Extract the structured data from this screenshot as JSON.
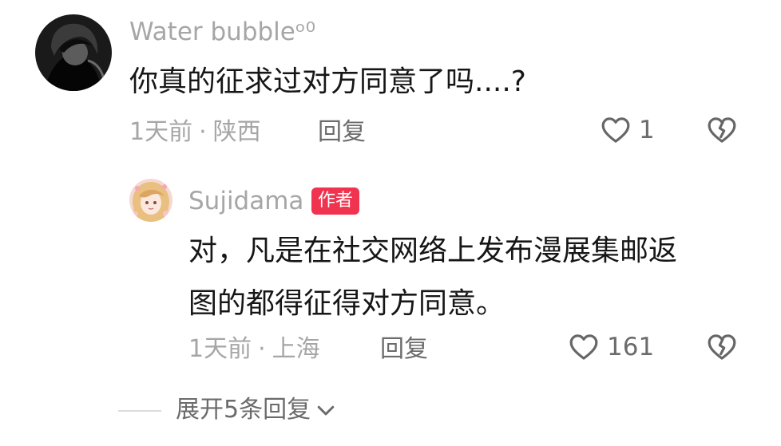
{
  "comment": {
    "username": "Water bubbleᵒ⁰",
    "text": "你真的征求过对方同意了吗....?",
    "time": "1天前",
    "separator": "·",
    "location": "陕西",
    "reply_label": "回复",
    "like_count": "1"
  },
  "reply": {
    "username": "Sujidama",
    "badge": "作者",
    "text_line1": "对，凡是在社交网络上发布漫展集邮返",
    "text_line2": "图的都得征得对方同意。",
    "time": "1天前",
    "separator": "·",
    "location": "上海",
    "reply_label": "回复",
    "like_count": "161"
  },
  "expand": {
    "label": "展开5条回复"
  },
  "colors": {
    "badge_bg": "#f0334e",
    "text_primary": "#161616",
    "text_secondary": "#a6a6a6",
    "text_action": "#6b6b6b"
  }
}
